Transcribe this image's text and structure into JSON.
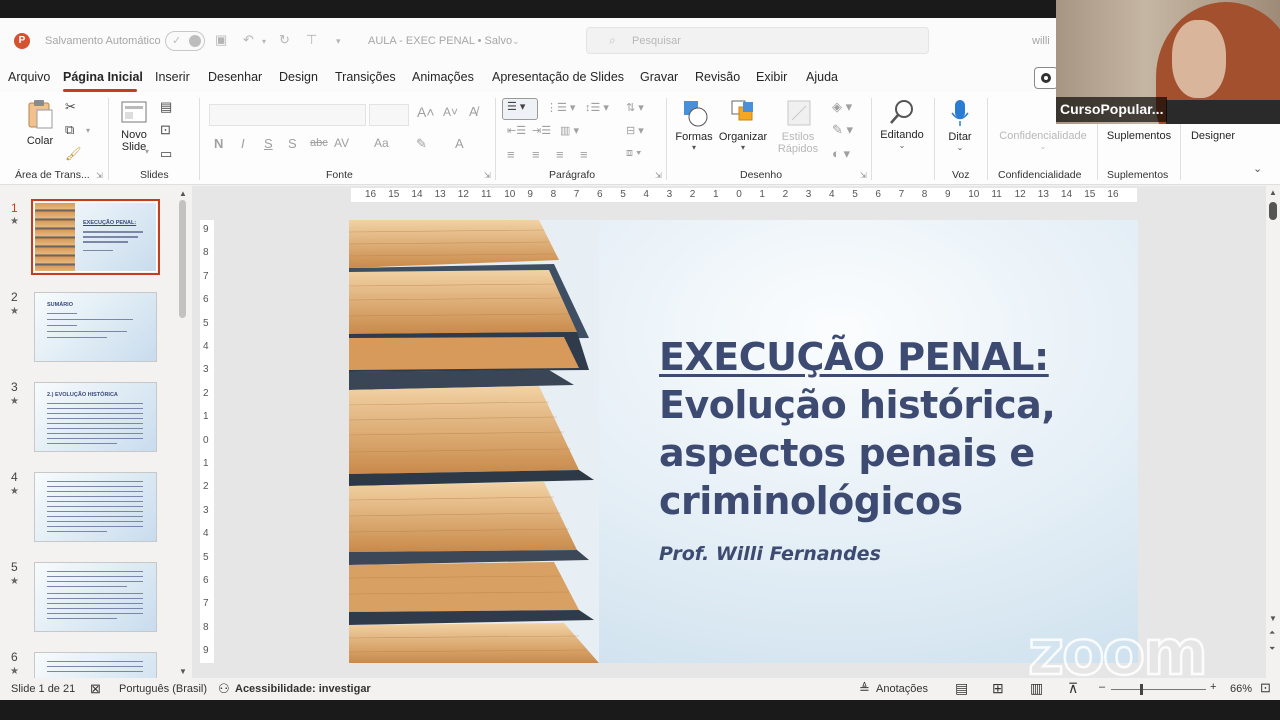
{
  "titlebar": {
    "autosave_label": "Salvamento Automático",
    "document_title": "AULA - EXEC PENAL • Salvo",
    "search_placeholder": "Pesquisar",
    "user_truncated": "willi"
  },
  "menu": {
    "items": [
      "Arquivo",
      "Página Inicial",
      "Inserir",
      "Desenhar",
      "Design",
      "Transições",
      "Animações",
      "Apresentação de Slides",
      "Gravar",
      "Revisão",
      "Exibir",
      "Ajuda"
    ],
    "active": "Página Inicial"
  },
  "ribbon": {
    "paste": "Colar",
    "new_slide_line1": "Novo",
    "new_slide_line2": "Slide",
    "shapes": "Formas",
    "arrange": "Organizar",
    "quick_styles_line1": "Estilos",
    "quick_styles_line2": "Rápidos",
    "editing": "Editando",
    "dictate": "Ditar",
    "sensitivity": "Confidencialidade",
    "addins": "Suplementos",
    "designer": "Designer",
    "groups": {
      "clipboard": "Área de Trans...",
      "slides": "Slides",
      "font": "Fonte",
      "paragraph": "Parágrafo",
      "drawing": "Desenho",
      "voice": "Voz",
      "sensitivity": "Confidencialidade",
      "addins": "Suplementos"
    },
    "font_buttons": [
      "N",
      "I",
      "S",
      "S",
      "abc",
      "AV",
      "Aa"
    ]
  },
  "thumbnails": [
    {
      "num": "1",
      "title": "EXECUÇÃO PENAL:"
    },
    {
      "num": "2",
      "title": "SUMÁRIO"
    },
    {
      "num": "3",
      "title": "2.) EVOLUÇÃO HISTÓRICA"
    },
    {
      "num": "4",
      "title": ""
    },
    {
      "num": "5",
      "title": ""
    },
    {
      "num": "6",
      "title": ""
    }
  ],
  "ruler": {
    "horizontal": [
      "16",
      "15",
      "14",
      "13",
      "12",
      "11",
      "10",
      "9",
      "8",
      "7",
      "6",
      "5",
      "4",
      "3",
      "2",
      "1",
      "0",
      "1",
      "2",
      "3",
      "4",
      "5",
      "6",
      "7",
      "8",
      "9",
      "10",
      "11",
      "12",
      "13",
      "14",
      "15",
      "16"
    ],
    "vertical": [
      "9",
      "8",
      "7",
      "6",
      "5",
      "4",
      "3",
      "2",
      "1",
      "0",
      "1",
      "2",
      "3",
      "4",
      "5",
      "6",
      "7",
      "8",
      "9"
    ]
  },
  "slide": {
    "title_line1": "EXECUÇÃO PENAL:",
    "title_line2": "Evolução histórica,",
    "title_line3": "aspectos penais e",
    "title_line4": "criminológicos",
    "author": "Prof. Willi Fernandes"
  },
  "webcam": {
    "name": "CursoPopular..."
  },
  "watermark": "zoom",
  "statusbar": {
    "slide_count": "Slide 1 de 21",
    "language": "Português (Brasil)",
    "accessibility": "Acessibilidade: investigar",
    "notes": "Anotações",
    "zoom_level": "66%"
  },
  "colors": {
    "accent": "#c43e1c",
    "slide_title": "#3d4a72",
    "ppt_logo": "#d35230"
  }
}
